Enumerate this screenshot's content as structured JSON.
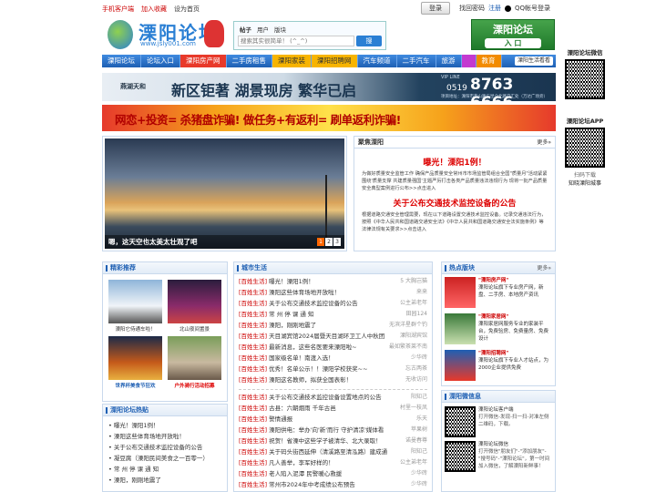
{
  "topbar": {
    "links": [
      "手机客户端",
      "加入收藏",
      "设为首页"
    ],
    "login": "登录",
    "register_links": "找回密码",
    "reg": "注册",
    "qq": "QQ帐号登录"
  },
  "logo": {
    "title": "溧阳论坛",
    "url": "www.jsly001.com"
  },
  "search": {
    "tabs": [
      "帖子",
      "用户",
      "版块"
    ],
    "placeholder": "搜索其实很简单！ (^_^)",
    "button": "搜"
  },
  "right_logo": {
    "title": "溧阳论坛",
    "sub": "入 口"
  },
  "nav": {
    "items": [
      "溧阳论坛",
      "论坛入口",
      "溧阳房产网",
      "二手房租售",
      "溧阳家装",
      "溧阳招聘网",
      "汽车频道",
      "二手汽车",
      "旅游",
      "",
      "教育"
    ],
    "select": "溧阳生活看看"
  },
  "banner1": {
    "brand": "燕湖天和",
    "text": "新区钜著  湖景现房  繁华已启",
    "vip": "VIP LINE",
    "phone": "8763 6666",
    "area": "0519",
    "addr": "项目地址：溧阳市燕山路与昆仑北路交汇处（万达广场旁）"
  },
  "banner2": {
    "text": "网恋+投资= 杀猪盘诈骗!  做任务+有返利= 刷单返利诈骗!"
  },
  "slider": {
    "caption": "嗯，这天空也太美太壮观了吧",
    "pages": [
      "1",
      "2",
      "3"
    ]
  },
  "focus": {
    "title": "聚焦溧阳",
    "more": "更多»",
    "h1": "曝光！溧阳1例！",
    "p1": "为做好质量安全监管工作 确保产品质量安全常州市市场监管局组合全国\"质量月\"活动紧紧围绕'质量支撑 共建质量强国'主题严厉打击各类产品质量违法违规行为 现将一批产品质量安全典型案例进行公布>>点击进入",
    "h2": "关于公布交通技术监控设备的公告",
    "p2": "根据道路交通安全管理需要，现在以下道路设置交通技术监控设备。记录交通违法行为，按照《中华人民共和国道路交通安全法》《中华人民共和国道路交通安全法实施条例》等法律法规有关要求>>点击进入"
  },
  "picks": {
    "title": "精彩推荐",
    "items": [
      "溧阳它侍通车啦！",
      "北山夜间置景",
      "世界杯美食节狂欢",
      "户外骑行活动招募"
    ]
  },
  "hot_posts": {
    "title": "溧阳论坛热贴",
    "items": [
      "曝光！溧阳1例！",
      "溧阳这些体育场地开放啦！",
      "关于公布交通技术监控设备的公告",
      "凝豆腐（溧阳民间美食之一百零一）",
      "常 州 停 课 通 知",
      "溧阳，刚刚地震了"
    ]
  },
  "city": {
    "title": "城市生活",
    "rows1": [
      [
        "[百姓生活]",
        "曝光！溧阳1例！",
        "5 大胸岂猫"
      ],
      [
        "[百姓生活]",
        "溧阳这些体育场地开放啦！",
        "来来"
      ],
      [
        "[百姓生活]",
        "关于公布交通技术监控设备的公告",
        "公主弟老年"
      ],
      [
        "[百姓生活]",
        "常 州 停 课 通 知",
        "田园124"
      ],
      [
        "[百姓生活]",
        "溧阳，刚刚地震了",
        "无滨洋星群个钓"
      ],
      [
        "[百姓生活]",
        "天目湖宾馆2024届暨天目湖环卫工人中秋团",
        "溧阳湖宾馆"
      ],
      [
        "[百姓生活]",
        "最新消息，这些名医要来溧阳啦~",
        "最如繁茶莱不南"
      ],
      [
        "[百姓生活]",
        "国家级名单！南渡入选！",
        "少华砖"
      ],
      [
        "[百姓生活]",
        "优秀！名单公示！！溧阳学校获奖~~",
        "忘古两茶"
      ],
      [
        "[百姓生活]",
        "溧阳这名教师，拟获全国表彰！",
        "无收访问"
      ]
    ],
    "rows2": [
      [
        "[百姓生活]",
        "关于公布交通技术监控设备设置地点的公告",
        "阳知己"
      ],
      [
        "[百姓生活]",
        "古县：六朝烟雨 千年古邑",
        "村里一枝凤"
      ],
      [
        "[百姓生活]",
        "警情通报",
        "乐天"
      ],
      [
        "[百姓生活]",
        "溧阳供电：举办'向'新'而行 守护清凉'媒体看",
        "苹果树"
      ],
      [
        "[百姓生活]",
        "祝贺！省溧中这些学子被清华、北大录取！",
        "诺曼春尊"
      ],
      [
        "[百姓生活]",
        "关于码头街西延伸（清溪路至清泓路）建成通",
        "阳知己"
      ],
      [
        "[百姓生活]",
        "凡人善举，李军好样的！",
        "公主弟老年"
      ],
      [
        "[百姓生活]",
        "老人陷入泥潭 民警暖心救援",
        "少华砖"
      ],
      [
        "[百姓生活]",
        "常州市2024年中考成绩公布预告",
        "少华砖"
      ]
    ]
  },
  "wechat_right": {
    "title": "溧阳论坛微信",
    "app": "溧阳论坛APP",
    "app_sub": "扫码下载",
    "know": "知晓溧阳城事"
  },
  "hot_boards": {
    "title": "热点版块",
    "more": "更多»",
    "items": [
      {
        "name": "\"溧阳房产网\"",
        "desc": "溧阳论坛旗下专业房产网，新盘、二手房、本地房产资讯"
      },
      {
        "name": "\"溧阳家居网\"",
        "desc": "溧阳家居网服务专业的家装平台，免费验房、免费量房、免费设计"
      },
      {
        "name": "\"溧阳招聘网\"",
        "desc": "溧阳论坛旗下专业人才站点，为2000企业提供免费"
      }
    ]
  },
  "wx": {
    "title": "溧阳微信息",
    "a_title": "溧阳论坛客户端",
    "a_desc": "打开微信-发现-扫一扫-对准左侧二维码，下载。",
    "b_title": "溧阳论坛微信",
    "b_desc": "打开微信\"朋友们\"-\"添加朋友\"-\"搜号码\"-\"溧阳论坛\"，第一时间加入微信，了解溧阳新鲜事！"
  }
}
